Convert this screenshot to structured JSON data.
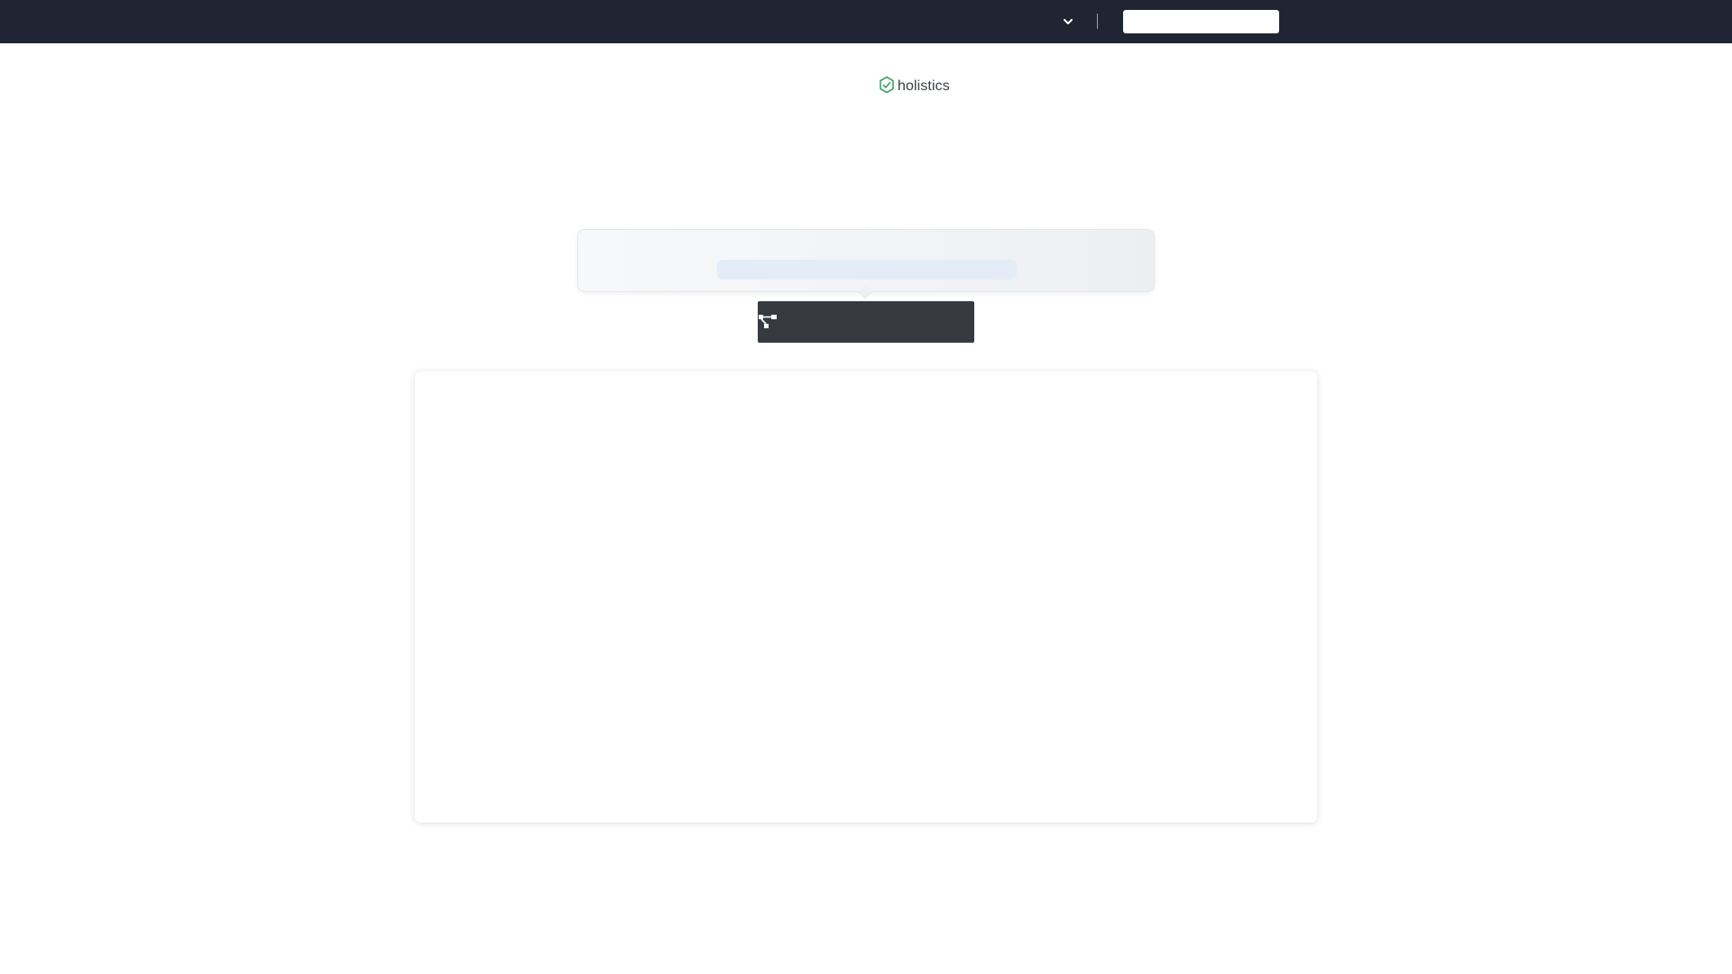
{
  "topbar": {
    "dropdown_icon": "chevron-down-icon",
    "cta_label": ""
  },
  "logo": {
    "icon": "hexagon-check-icon",
    "text": "holistics",
    "accent": "#3ea36b"
  },
  "prompt": {
    "text": ""
  },
  "tooltip": {
    "icon": "tree-diagram-icon",
    "label": ""
  },
  "colors": {
    "topbar_bg": "#1f2532",
    "tooltip_bg": "#373a41",
    "pill_bg": "#e4ecf8"
  }
}
